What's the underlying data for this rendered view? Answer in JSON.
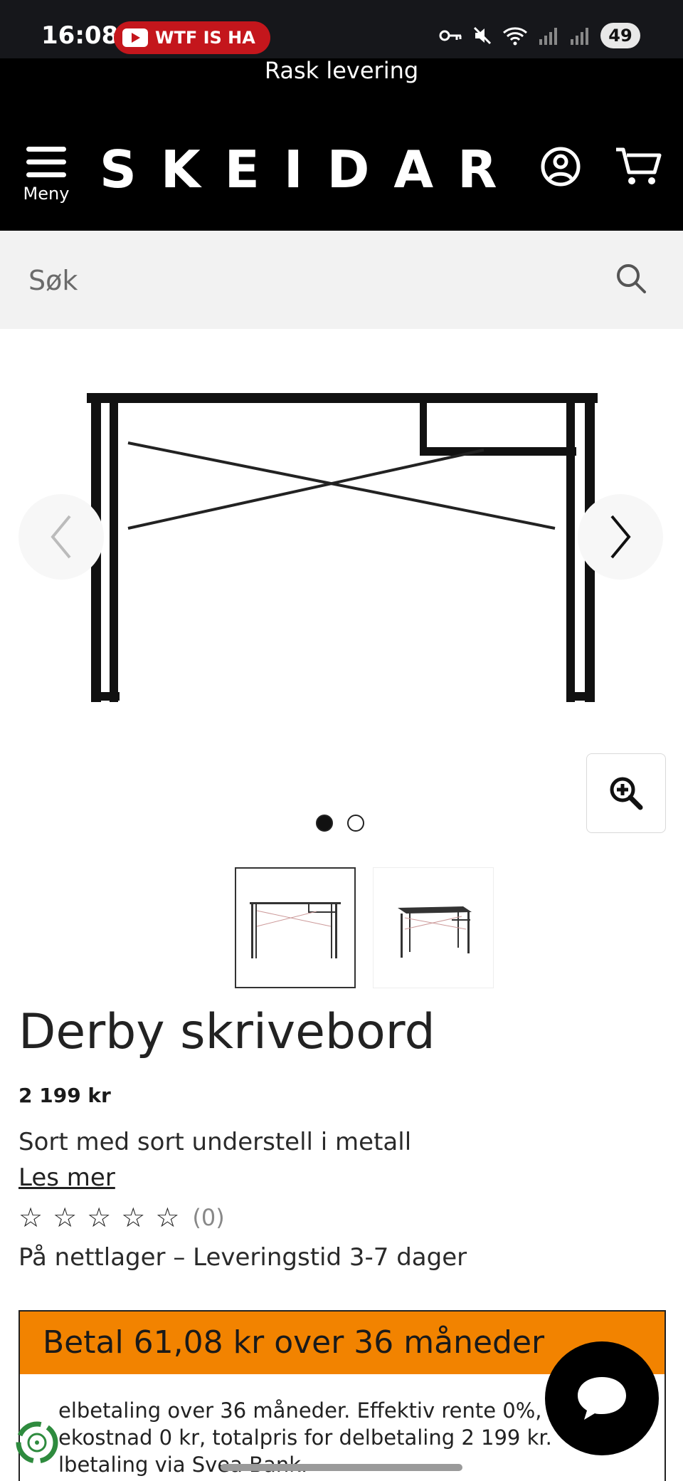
{
  "status_bar": {
    "time": "16:08",
    "notification": "WTF IS HA",
    "battery": "49"
  },
  "promo": {
    "text": "Rask levering"
  },
  "header": {
    "menu_label": "Meny",
    "logo": "SKEIDAR"
  },
  "search": {
    "placeholder": "Søk"
  },
  "gallery": {
    "slide_count": 2,
    "active_slide": 1
  },
  "product": {
    "title": "Derby skrivebord",
    "price": "2 199 kr",
    "description": "Sort med sort understell i metall",
    "read_more": "Les mer",
    "rating_stars": 0,
    "rating_count": "(0)",
    "stock": "På nettlager – Leveringstid 3-7 dager"
  },
  "finance": {
    "headline": "Betal 61,08 kr over 36 måneder",
    "body": "elbetaling over 36 måneder. Effektiv rente 0%, ekostnad 0 kr, totalpris for delbetaling 2 199 kr. lbetaling via Svea Bank.",
    "accent_color": "#f28300"
  },
  "colors": {
    "header_bg": "#000000",
    "search_bg": "#f2f2f2",
    "status_pill": "#c4161c"
  }
}
